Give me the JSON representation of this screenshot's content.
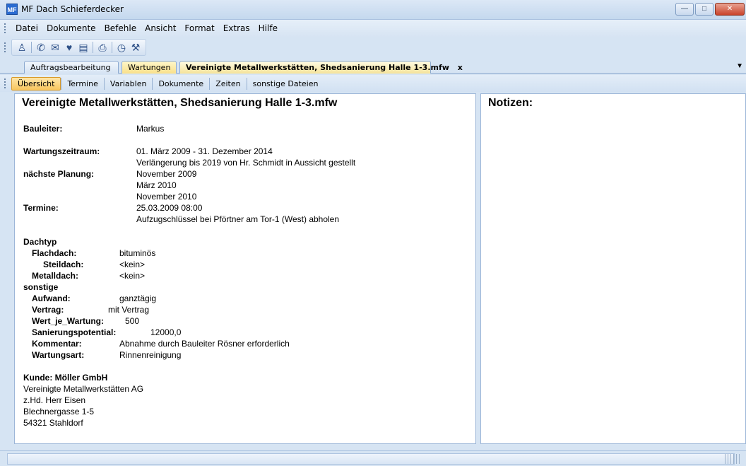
{
  "window": {
    "title": "MF Dach Schieferdecker",
    "app_icon": "MF"
  },
  "menu": [
    "Datei",
    "Dokumente",
    "Befehle",
    "Ansicht",
    "Format",
    "Extras",
    "Hilfe"
  ],
  "tabs": {
    "doc1": "Auftragsbearbeitung",
    "doc2": "Wartungen",
    "doc3": "Vereinigte Metallwerkstätten, Shedsanierung Halle 1-3.mfw",
    "close": "x"
  },
  "subtabs": [
    "Übersicht",
    "Termine",
    "Variablen",
    "Dokumente",
    "Zeiten",
    "sonstige Dateien"
  ],
  "main": {
    "title": "Vereinigte Metallwerkstätten, Shedsanierung Halle 1-3.mfw",
    "bauleiter_label": "Bauleiter:",
    "bauleiter_value": "Markus",
    "zeitraum_label": "Wartungszeitraum:",
    "zeitraum_value": "01. März 2009  -  31. Dezember 2014",
    "zeitraum_note": "Verlängerung bis 2019 von Hr. Schmidt in Aussicht gestellt",
    "planung_label": "nächste Planung:",
    "planung_values": [
      "November 2009",
      "März 2010",
      "November 2010"
    ],
    "termine_label": "Termine:",
    "termine_value": "25.03.2009 08:00",
    "termine_note": "Aufzugschlüssel bei Pförtner am Tor-1 (West) abholen",
    "dachtyp_label": "Dachtyp",
    "flachdach_label": "Flachdach:",
    "flachdach_value": "bituminös",
    "steildach_label": "Steildach:",
    "steildach_value": "<kein>",
    "metalldach_label": "Metalldach:",
    "metalldach_value": "<kein>",
    "sonstige_label": "sonstige",
    "aufwand_label": "Aufwand:",
    "aufwand_value": "ganztägig",
    "vertrag_label": "Vertrag:",
    "vertrag_value": "mit Vertrag",
    "wert_label": "Wert_je_Wartung:",
    "wert_value": "500",
    "sanierung_label": "Sanierungspotential:",
    "sanierung_value": "12000,0",
    "kommentar_label": "Kommentar:",
    "kommentar_value": "Abnahme durch Bauleiter Rösner erforderlich",
    "wartungsart_label": "Wartungsart:",
    "wartungsart_value": "Rinnenreinigung",
    "kunde_label": "Kunde: Möller GmbH",
    "kunde_lines": [
      "Vereinigte Metallwerkstätten AG",
      "z.Hd. Herr Eisen",
      "Blechnergasse 1-5",
      "54321 Stahldorf"
    ]
  },
  "notes": {
    "title": "Notizen:"
  }
}
